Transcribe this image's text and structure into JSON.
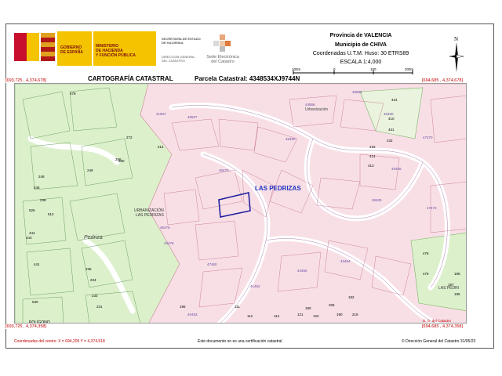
{
  "header": {
    "gov_line1": "GOBIERNO",
    "gov_line2": "DE ESPAÑA",
    "min_line1": "MINISTERIO",
    "min_line2": "DE HACIENDA",
    "min_line3": "Y FUNCIÓN PÚBLICA",
    "sec_line1": "SECRETARÍA DE ESTADO",
    "sec_line2": "DE HACIENDA",
    "dg_line1": "DIRECCIÓN GENERAL",
    "dg_line2": "DEL CATASTRO",
    "sede_line1": "Sede Electrónica",
    "sede_line2": "del Catastro",
    "province": "Provincia de VALENCIA",
    "municipality": "Municipio de CHIVA",
    "coords": "Coordenadas U.T.M. Huso: 30 ETRS89",
    "scale": "ESCALA 1:4,000",
    "north": "N",
    "scale_ticks": [
      "100m",
      "0",
      "100",
      "200m"
    ]
  },
  "title_left": "CARTOGRAFÍA CATASTRAL",
  "title_parcel": "Parcela Catastral: 4348534XJ9744N",
  "corners": {
    "top_left": "[693,725 , 4,374,678]",
    "top_right": "[694,685 , 4,374,678]",
    "bottom_left": "[693,725 , 4,374,358]",
    "bottom_right": "[694,685 , 4,374,358]"
  },
  "map_labels": {
    "las_pedrizas": "LAS PEDRIZAS",
    "urbanizacion": "Urbanización",
    "urb_pedrizas_1": "URBANIZACIÓN",
    "urb_pedrizas_2": "LAS PEDRIZAS",
    "pedriza": "Pedriza",
    "las_pedri": "LAS PEDRI",
    "poligono": "POLÍGONO",
    "dg_catastro": "D. G. del Catastro",
    "parcels_pink": [
      "45583",
      "44566",
      "41507",
      "45507",
      "46450",
      "46470",
      "45466",
      "47473",
      "47470",
      "43464",
      "45476",
      "43476",
      "47460",
      "40453",
      "46460",
      "45530",
      "41452",
      "44465"
    ],
    "parcels_green": [
      "478",
      "214",
      "272",
      "250",
      "249",
      "256",
      "248",
      "246",
      "238",
      "525",
      "512",
      "444",
      "443",
      "441",
      "234",
      "236",
      "231",
      "233",
      "530",
      "424",
      "410",
      "431",
      "432",
      "415",
      "414",
      "413",
      "476",
      "475",
      "198",
      "195",
      "197",
      "196",
      "111",
      "112",
      "114",
      "121",
      "122",
      "190",
      "215",
      "205",
      "182",
      "180"
    ]
  },
  "footer": {
    "center_coords": "Coordenadas del centro: X = 694,205 Y = 4,374,518",
    "notice": "Este documento no es una certificación catastral",
    "copyright": "© Dirección General del Catastro 31/05/23"
  }
}
